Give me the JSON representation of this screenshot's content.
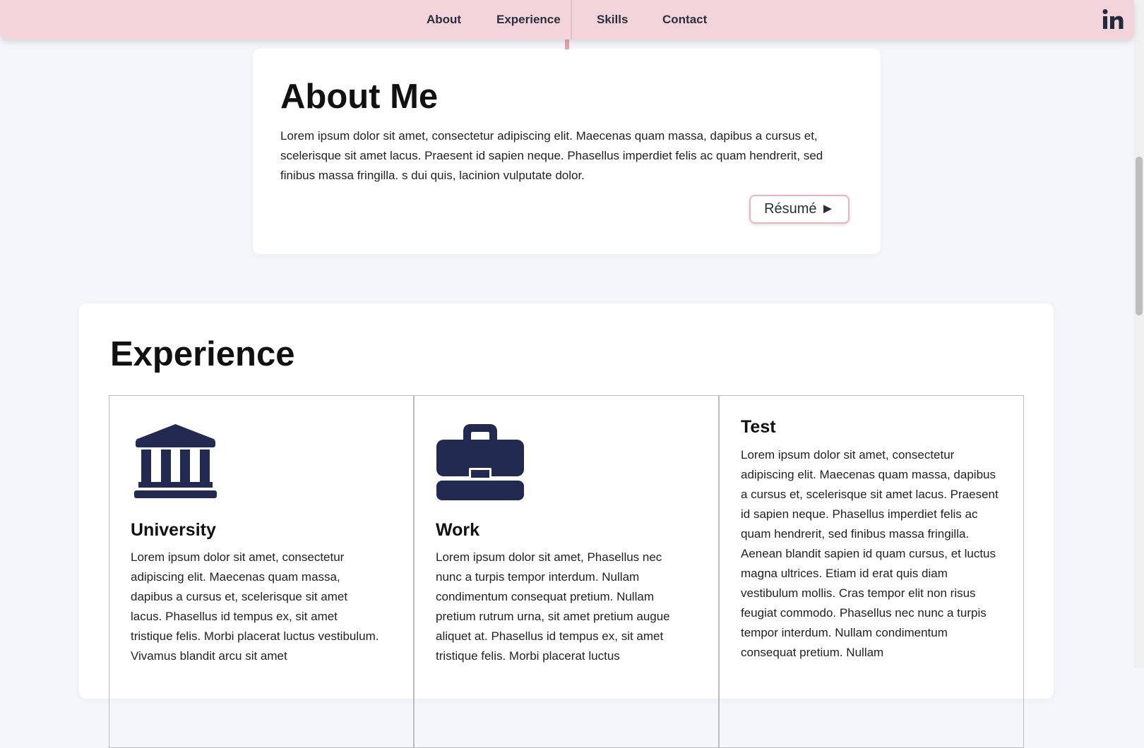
{
  "nav": {
    "links": [
      "About",
      "Experience",
      "Skills",
      "Contact"
    ],
    "social_icon": "linkedin-icon"
  },
  "about": {
    "title": "About Me",
    "text": "Lorem ipsum dolor sit amet, consectetur adipiscing elit. Maecenas quam massa, dapibus a cursus et, scelerisque sit amet lacus. Praesent id sapien neque. Phasellus imperdiet felis ac quam hendrerit, sed finibus massa fringilla. s dui quis, lacinion vulputate dolor.",
    "resume_label": "Résumé ►"
  },
  "experience": {
    "title": "Experience",
    "columns": [
      {
        "icon": "university-icon",
        "title": "University",
        "text": "Lorem ipsum dolor sit amet, consectetur adipiscing elit. Maecenas quam massa, dapibus a cursus et, scelerisque sit amet lacus. Phasellus id tempus ex, sit amet tristique felis. Morbi placerat luctus vestibulum. Vivamus blandit arcu sit amet"
      },
      {
        "icon": "briefcase-icon",
        "title": "Work",
        "text": "Lorem ipsum dolor sit amet, Phasellus nec nunc a turpis tempor interdum. Nullam condimentum consequat pretium. Nullam pretium rutrum urna, sit amet pretium augue aliquet at. Phasellus id tempus ex, sit amet tristique felis. Morbi placerat luctus"
      },
      {
        "title": "Test",
        "text": "Lorem ipsum dolor sit amet, consectetur adipiscing elit. Maecenas quam massa, dapibus a cursus et, scelerisque sit amet lacus. Praesent id sapien neque. Phasellus imperdiet felis ac quam hendrerit, sed finibus massa fringilla. Aenean blandit sapien id quam cursus, et luctus magna ultrices. Etiam id erat quis diam vestibulum mollis. Cras tempor elit non risus feugiat commodo. Phasellus nec nunc a turpis tempor interdum. Nullam condimentum consequat pretium. Nullam"
      }
    ]
  },
  "colors": {
    "navbar_bg": "#f2d4da",
    "page_bg": "#f4f6fb",
    "icon_color": "#232a52",
    "accent_border": "#eab3be"
  }
}
